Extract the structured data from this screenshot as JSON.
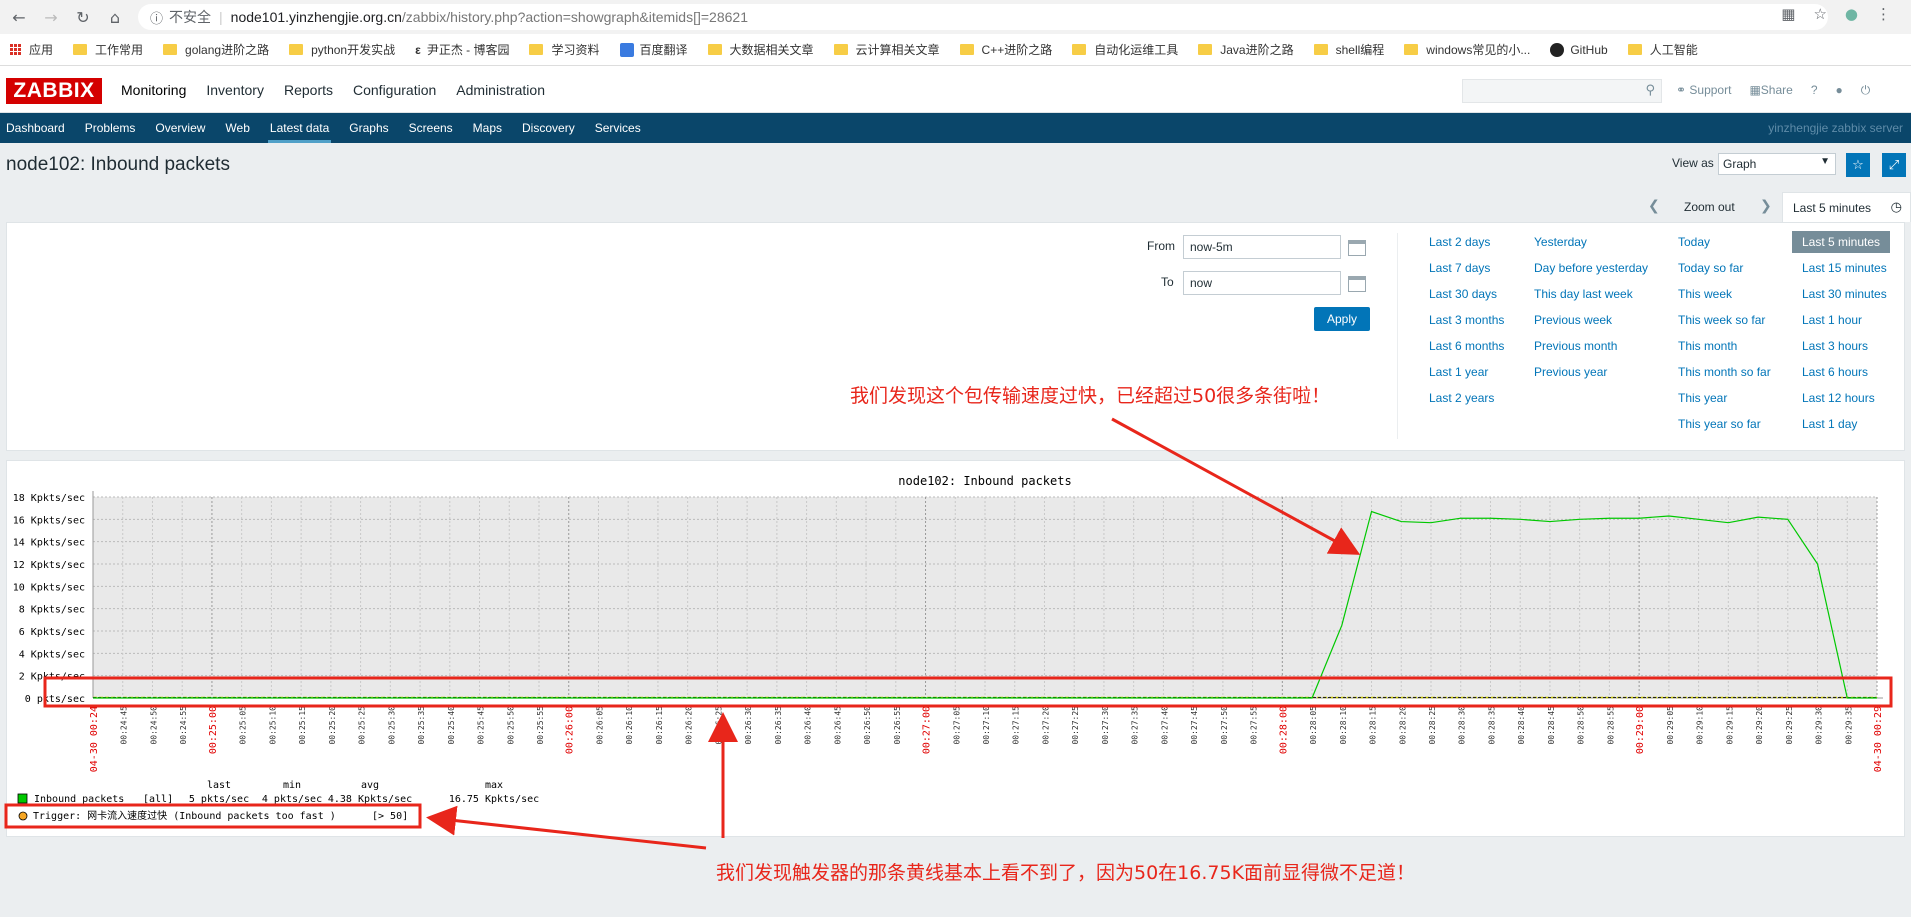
{
  "browser": {
    "insecure_label": "不安全",
    "url_host": "node101.yinzhengjie.org.cn",
    "url_path": "/zabbix/history.php?action=showgraph&itemids[]=28621",
    "bookmarks": [
      "应用",
      "工作常用",
      "golang进阶之路",
      "python开发实战",
      "尹正杰 - 博客园",
      "学习资料",
      "百度翻译",
      "大数据相关文章",
      "云计算相关文章",
      "C++进阶之路",
      "自动化运维工具",
      "Java进阶之路",
      "shell编程",
      "windows常见的小...",
      "GitHub",
      "人工智能"
    ]
  },
  "header": {
    "logo": "ZABBIX",
    "menu": [
      "Monitoring",
      "Inventory",
      "Reports",
      "Configuration",
      "Administration"
    ],
    "support": "Support",
    "share": "Share",
    "help": "?"
  },
  "submenu": {
    "items": [
      "Dashboard",
      "Problems",
      "Overview",
      "Web",
      "Latest data",
      "Graphs",
      "Screens",
      "Maps",
      "Discovery",
      "Services"
    ],
    "server": "yinzhengjie zabbix server"
  },
  "page": {
    "title": "node102: Inbound packets",
    "view_as_label": "View as",
    "view_as_value": "Graph"
  },
  "timebar": {
    "zoom_out": "Zoom out",
    "current": "Last 5 minutes"
  },
  "filter": {
    "from_label": "From",
    "from_value": "now-5m",
    "to_label": "To",
    "to_value": "now",
    "apply": "Apply",
    "columns": [
      [
        "Last 2 days",
        "Last 7 days",
        "Last 30 days",
        "Last 3 months",
        "Last 6 months",
        "Last 1 year",
        "Last 2 years"
      ],
      [
        "Yesterday",
        "Day before yesterday",
        "This day last week",
        "Previous week",
        "Previous month",
        "Previous year"
      ],
      [
        "Today",
        "Today so far",
        "This week",
        "This week so far",
        "This month",
        "This month so far",
        "This year",
        "This year so far"
      ],
      [
        "Last 5 minutes",
        "Last 15 minutes",
        "Last 30 minutes",
        "Last 1 hour",
        "Last 3 hours",
        "Last 6 hours",
        "Last 12 hours",
        "Last 1 day"
      ]
    ]
  },
  "chart_data": {
    "type": "line",
    "title": "node102: Inbound packets",
    "ylabel": "",
    "yunit": "Kpkts/sec",
    "y_ticks": [
      "18 Kpkts/sec",
      "16 Kpkts/sec",
      "14 Kpkts/sec",
      "12 Kpkts/sec",
      "10 Kpkts/sec",
      "8 Kpkts/sec",
      "6 Kpkts/sec",
      "4 Kpkts/sec",
      "2 Kpkts/sec",
      "0 pkts/sec"
    ],
    "ylim": [
      0,
      18
    ],
    "x_ticks": [
      "04-30 00:24",
      "00:24:45",
      "00:24:50",
      "00:24:55",
      "00:25:00",
      "00:25:05",
      "00:25:10",
      "00:25:15",
      "00:25:20",
      "00:25:25",
      "00:25:30",
      "00:25:35",
      "00:25:40",
      "00:25:45",
      "00:25:50",
      "00:25:55",
      "00:26:00",
      "00:26:05",
      "00:26:10",
      "00:26:15",
      "00:26:20",
      "00:26:25",
      "00:26:30",
      "00:26:35",
      "00:26:40",
      "00:26:45",
      "00:26:50",
      "00:26:55",
      "00:27:00",
      "00:27:05",
      "00:27:10",
      "00:27:15",
      "00:27:20",
      "00:27:25",
      "00:27:30",
      "00:27:35",
      "00:27:40",
      "00:27:45",
      "00:27:50",
      "00:27:55",
      "00:28:00",
      "00:28:05",
      "00:28:10",
      "00:28:15",
      "00:28:20",
      "00:28:25",
      "00:28:30",
      "00:28:35",
      "00:28:40",
      "00:28:45",
      "00:28:50",
      "00:28:55",
      "00:29:00",
      "00:29:05",
      "00:29:10",
      "00:29:15",
      "00:29:20",
      "00:29:25",
      "00:29:30",
      "00:29:35",
      "04-30 00:29"
    ],
    "red_tick_indices": [
      0,
      4,
      16,
      28,
      40,
      52,
      60
    ],
    "grid": true,
    "series": [
      {
        "name": "Inbound packets",
        "color": "#00c800",
        "x_index": [
          0,
          41,
          42,
          43,
          44,
          45,
          46,
          47,
          48,
          49,
          50,
          51,
          52,
          53,
          54,
          55,
          56,
          57,
          58,
          59,
          60
        ],
        "values": [
          0,
          0,
          6.5,
          16.7,
          15.8,
          15.7,
          16.1,
          16.1,
          16.0,
          15.8,
          16.0,
          16.1,
          16.1,
          16.3,
          16.0,
          15.7,
          16.2,
          16.0,
          12.0,
          0,
          0
        ]
      }
    ],
    "trigger": {
      "value": 0.05,
      "color": "#c8c800"
    },
    "legend": {
      "headers": [
        "last",
        "min",
        "avg",
        "max"
      ],
      "series_label": "Inbound packets",
      "func": "[all]",
      "last": "5 pkts/sec",
      "min": "4 pkts/sec",
      "avg": "4.38 Kpkts/sec",
      "max": "16.75 Kpkts/sec",
      "trigger_label": "Trigger: 网卡流入速度过快 (Inbound packets too fast )",
      "trigger_threshold": "[> 50]"
    }
  },
  "annotations": {
    "top": "我们发现这个包传输速度过快，已经超过50很多条街啦！",
    "bottom": "我们发现触发器的那条黄线基本上看不到了，因为50在16.75K面前显得微不足道！"
  }
}
